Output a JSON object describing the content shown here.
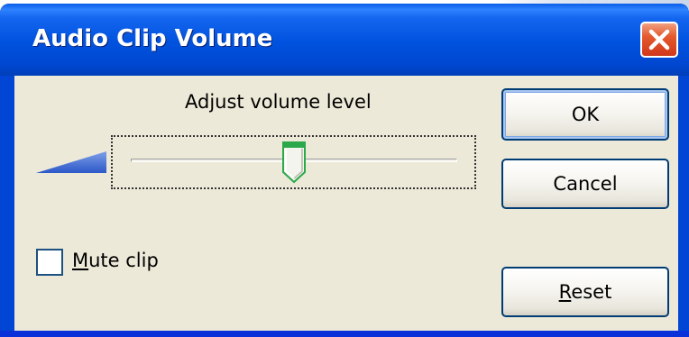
{
  "window": {
    "title": "Audio Clip Volume",
    "close_icon": "close-icon"
  },
  "slider": {
    "label": "Adjust volume level",
    "level_fraction": 0.5,
    "icon": "volume-wedge-icon"
  },
  "mute": {
    "prefix": "M",
    "rest": "ute clip",
    "checked": false
  },
  "buttons": {
    "ok": "OK",
    "cancel": "Cancel",
    "reset_prefix": "R",
    "reset_rest": "eset"
  },
  "colors": {
    "titlebar": "#0052de",
    "close": "#e45a2e",
    "dialog_bg": "#ece9d8",
    "thumb_accent": "#2ba84a"
  }
}
